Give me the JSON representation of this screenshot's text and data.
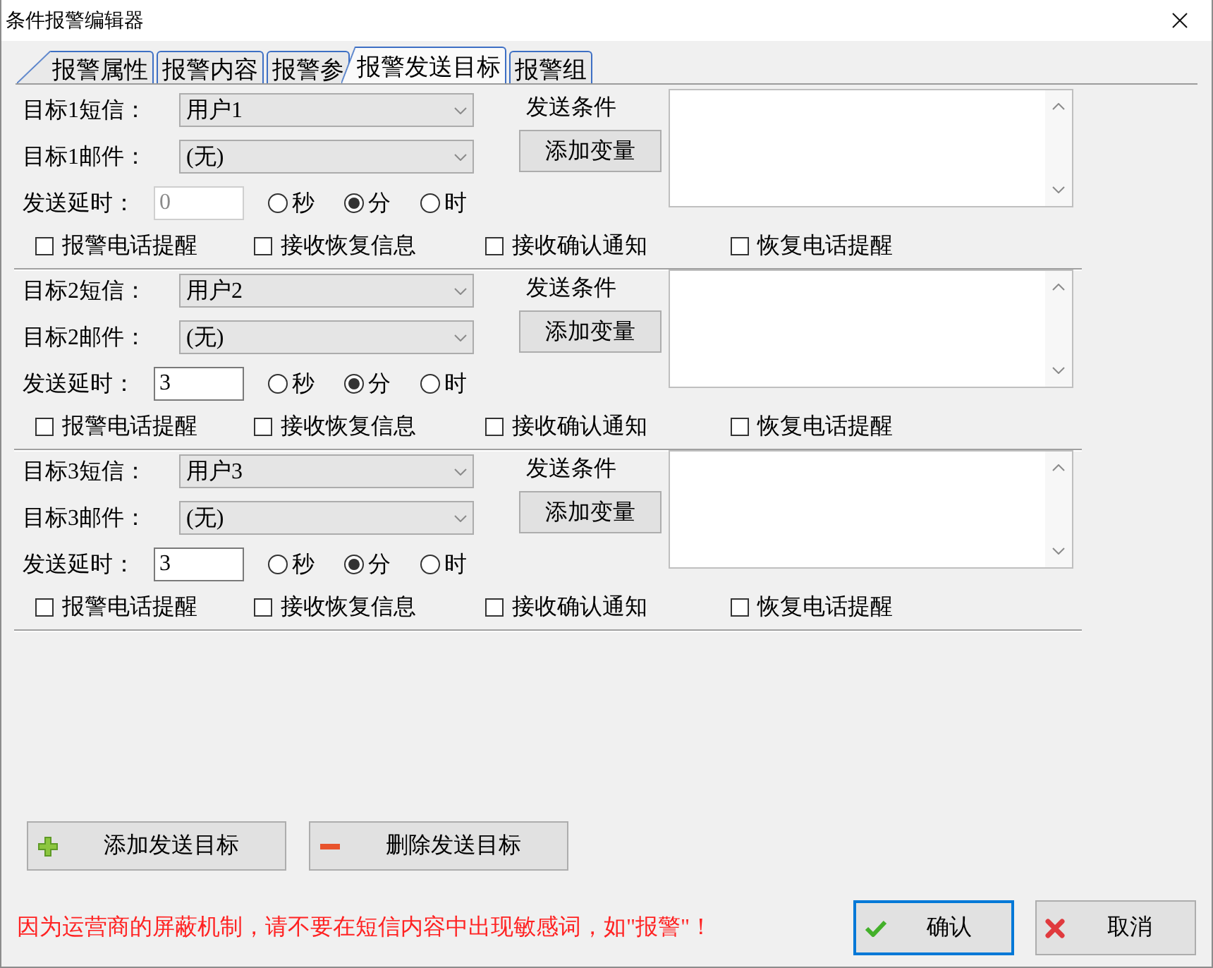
{
  "window": {
    "title": "条件报警编辑器"
  },
  "tabs": [
    {
      "label": "报警属性",
      "selected": false
    },
    {
      "label": "报警内容",
      "selected": false
    },
    {
      "label": "报警参",
      "selected": false
    },
    {
      "label": "报警发送目标",
      "selected": true
    },
    {
      "label": "报警组",
      "selected": false
    }
  ],
  "targets": [
    {
      "sms": {
        "label": "目标1短信：",
        "value": "用户1"
      },
      "mail": {
        "label": "目标1邮件：",
        "value": "(无)"
      },
      "delay": {
        "label": "发送延时：",
        "value": "0",
        "disabled": true
      },
      "units": [
        {
          "label": "秒",
          "selected": false
        },
        {
          "label": "分",
          "selected": true
        },
        {
          "label": "时",
          "selected": false
        }
      ],
      "condition": {
        "label": "发送条件",
        "button": "添加变量"
      },
      "options": [
        {
          "label": "报警电话提醒",
          "checked": false
        },
        {
          "label": "接收恢复信息",
          "checked": false
        },
        {
          "label": "接收确认通知",
          "checked": false
        },
        {
          "label": "恢复电话提醒",
          "checked": false
        }
      ]
    },
    {
      "sms": {
        "label": "目标2短信：",
        "value": "用户2"
      },
      "mail": {
        "label": "目标2邮件：",
        "value": "(无)"
      },
      "delay": {
        "label": "发送延时：",
        "value": "3",
        "disabled": false
      },
      "units": [
        {
          "label": "秒",
          "selected": false
        },
        {
          "label": "分",
          "selected": true
        },
        {
          "label": "时",
          "selected": false
        }
      ],
      "condition": {
        "label": "发送条件",
        "button": "添加变量"
      },
      "options": [
        {
          "label": "报警电话提醒",
          "checked": false
        },
        {
          "label": "接收恢复信息",
          "checked": false
        },
        {
          "label": "接收确认通知",
          "checked": false
        },
        {
          "label": "恢复电话提醒",
          "checked": false
        }
      ]
    },
    {
      "sms": {
        "label": "目标3短信：",
        "value": "用户3"
      },
      "mail": {
        "label": "目标3邮件：",
        "value": "(无)"
      },
      "delay": {
        "label": "发送延时：",
        "value": "3",
        "disabled": false
      },
      "units": [
        {
          "label": "秒",
          "selected": false
        },
        {
          "label": "分",
          "selected": true
        },
        {
          "label": "时",
          "selected": false
        }
      ],
      "condition": {
        "label": "发送条件",
        "button": "添加变量"
      },
      "options": [
        {
          "label": "报警电话提醒",
          "checked": false
        },
        {
          "label": "接收恢复信息",
          "checked": false
        },
        {
          "label": "接收确认通知",
          "checked": false
        },
        {
          "label": "恢复电话提醒",
          "checked": false
        }
      ]
    }
  ],
  "target_buttons": [
    {
      "kind": "add",
      "label": "添加发送目标"
    },
    {
      "kind": "remove",
      "label": "删除发送目标"
    }
  ],
  "notice": "因为运营商的屏蔽机制，请不要在短信内容中出现敏感词，如\"报警\"！",
  "dialog_buttons": [
    {
      "kind": "ok",
      "label": "确认",
      "focused": true
    },
    {
      "kind": "cancel",
      "label": "取消",
      "focused": false
    }
  ]
}
